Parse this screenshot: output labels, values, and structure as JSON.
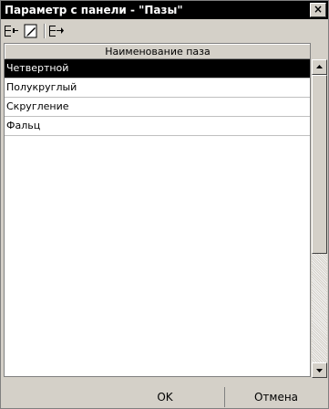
{
  "window": {
    "title": "Параметр с панели - \"Пазы\"",
    "close_glyph": "×"
  },
  "toolbar": {
    "items": [
      "insert-row-icon",
      "edit-icon",
      "append-row-icon"
    ]
  },
  "grid": {
    "header": "Наименование паза",
    "rows": [
      "Четвертной",
      "Полукруглый",
      "Скругление",
      "Фальц"
    ],
    "selected_index": 0
  },
  "footer": {
    "ok_label": "OK",
    "cancel_label": "Отмена"
  },
  "colors": {
    "selection": "#000000",
    "face": "#d4d0c8"
  }
}
